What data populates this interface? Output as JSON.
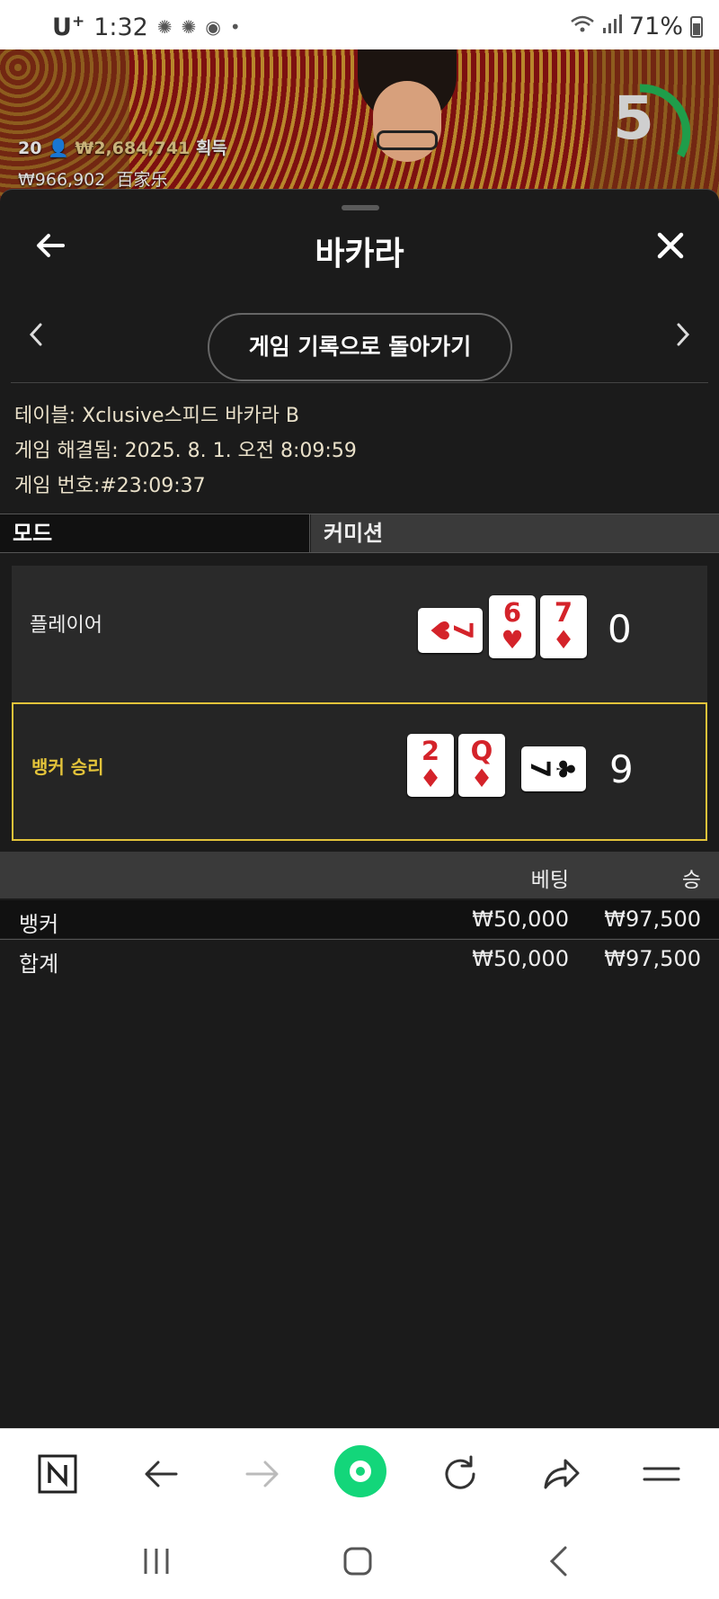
{
  "status_bar": {
    "carrier": "U",
    "carrier_plus": "+",
    "time": "1:32",
    "battery": "71%"
  },
  "video": {
    "people_count": "20",
    "win_amount": "₩2,684,741",
    "win_label": "획득",
    "balance": "₩966,902",
    "game_name": "百家乐",
    "countdown": "5"
  },
  "header": {
    "title": "바카라"
  },
  "nav": {
    "history_button": "게임 기록으로 돌아가기",
    "prev": "‹",
    "next": "›"
  },
  "info": {
    "table_label": "테이블:",
    "table_value": "Xclusive스피드 바카라 B",
    "resolved_label": "게임 해결됨:",
    "resolved_value": "2025. 8. 1. 오전 8:09:59",
    "number_label": "게임 번호:",
    "number_value": "#23:09:37"
  },
  "tabs": {
    "mode": "모드",
    "commission": "커미션"
  },
  "player": {
    "label": "플레이어",
    "score": "0",
    "cards": [
      {
        "rank": "7",
        "suit": "♥",
        "color": "#d4232a",
        "orientation": "sideways"
      },
      {
        "rank": "6",
        "suit": "♥",
        "color": "#d4232a",
        "orientation": "upright"
      },
      {
        "rank": "7",
        "suit": "♦",
        "color": "#d4232a",
        "orientation": "upright"
      }
    ]
  },
  "banker": {
    "label": "뱅커 승리",
    "score": "9",
    "accent": "#e3c33a",
    "cards": [
      {
        "rank": "2",
        "suit": "♦",
        "color": "#d4232a",
        "orientation": "upright"
      },
      {
        "rank": "Q",
        "suit": "♦",
        "color": "#d4232a",
        "orientation": "upright"
      },
      {
        "rank": "7",
        "suit": "♣",
        "color": "#111111",
        "orientation": "sideways"
      }
    ]
  },
  "bets": {
    "col_bet": "베팅",
    "col_win": "승",
    "rows": [
      {
        "name": "뱅커",
        "bet": "₩50,000",
        "win": "₩97,500"
      }
    ],
    "total": {
      "name": "합계",
      "bet": "₩50,000",
      "win": "₩97,500"
    }
  },
  "browser_bar": {
    "icons": [
      "naver-icon",
      "back-arrow-icon",
      "forward-arrow-icon",
      "home-icon",
      "refresh-icon",
      "share-icon",
      "menu-icon"
    ]
  }
}
